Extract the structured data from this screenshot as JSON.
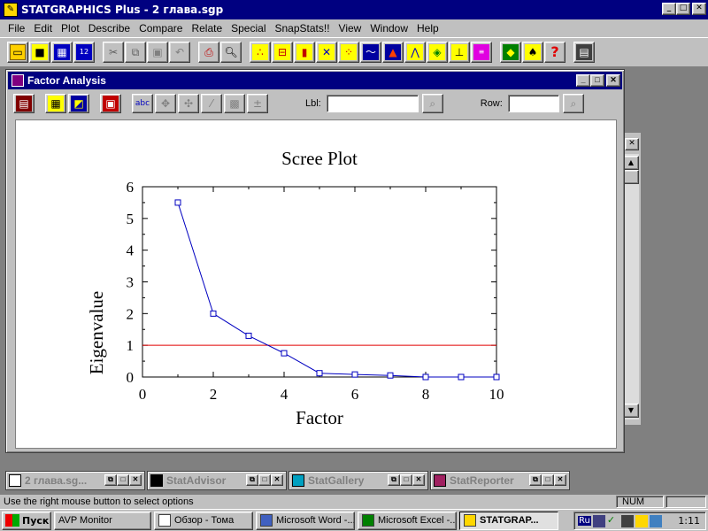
{
  "app": {
    "title": "STATGRAPHICS Plus - 2 глава.sgp",
    "menu": [
      "File",
      "Edit",
      "Plot",
      "Describe",
      "Compare",
      "Relate",
      "Special",
      "SnapStats!!",
      "View",
      "Window",
      "Help"
    ]
  },
  "toolbar_icons": [
    "open-icon",
    "save-icon",
    "datasheet-icon",
    "data-editor-icon",
    "cut-icon",
    "copy-icon",
    "paste-icon",
    "undo-icon",
    "print-icon",
    "print-preview-icon",
    "scatterplot-icon",
    "boxplot-icon",
    "histogram-icon",
    "xy-plot-icon",
    "matrix-plot-icon",
    "line-plot-icon",
    "distribution-icon",
    "time-series-icon",
    "3d-plot-icon",
    "tree-icon",
    "report-icon",
    "advisor-icon",
    "wizard-icon",
    "help-icon",
    "calculator-icon"
  ],
  "child_window": {
    "title": "Factor Analysis",
    "lbl_label": "Lbl:",
    "row_label": "Row:",
    "lbl_value": "",
    "row_value": ""
  },
  "chart_data": {
    "type": "line",
    "title": "Scree Plot",
    "xlabel": "Factor",
    "ylabel": "Eigenvalue",
    "xlim": [
      0,
      10
    ],
    "ylim": [
      0,
      6
    ],
    "xticks": [
      0,
      2,
      4,
      6,
      8,
      10
    ],
    "yticks": [
      0,
      1,
      2,
      3,
      4,
      5,
      6
    ],
    "series": [
      {
        "x": [
          1,
          2,
          3,
          4,
          5,
          6,
          7,
          8,
          9,
          10
        ],
        "values": [
          5.5,
          2.0,
          1.3,
          0.75,
          0.12,
          0.08,
          0.05,
          0.0,
          0.0,
          0.0
        ],
        "color": "#0000c0",
        "marker": "square"
      }
    ],
    "reference_line": {
      "y": 1,
      "color": "#e00000"
    }
  },
  "minimized_windows": [
    {
      "label": "2 глава.sg..."
    },
    {
      "label": "StatAdvisor"
    },
    {
      "label": "StatGallery"
    },
    {
      "label": "StatReporter"
    }
  ],
  "status": {
    "message": "Use the right mouse button to select options",
    "num": "NUM"
  },
  "taskbar": {
    "start": "Пуск",
    "tasks": [
      "AVP Monitor",
      "Обзор - Тома",
      "Microsoft Word -...",
      "Microsoft Excel -...",
      "STATGRAP..."
    ],
    "lang": "Ru",
    "clock": "1:11"
  }
}
